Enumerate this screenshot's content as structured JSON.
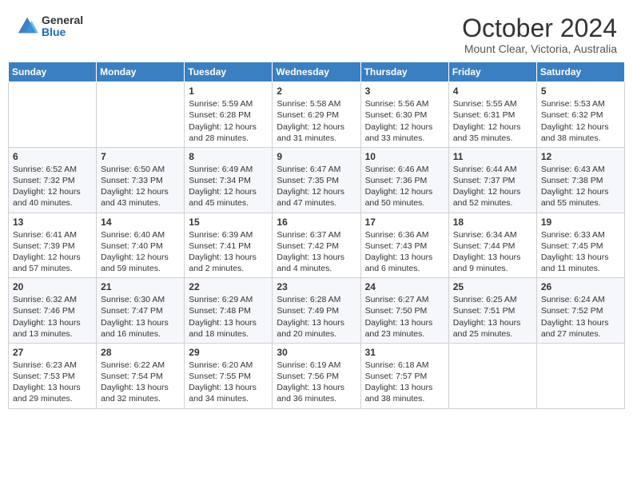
{
  "header": {
    "logo_general": "General",
    "logo_blue": "Blue",
    "title": "October 2024",
    "subtitle": "Mount Clear, Victoria, Australia"
  },
  "weekdays": [
    "Sunday",
    "Monday",
    "Tuesday",
    "Wednesday",
    "Thursday",
    "Friday",
    "Saturday"
  ],
  "weeks": [
    [
      {
        "day": "",
        "info": ""
      },
      {
        "day": "",
        "info": ""
      },
      {
        "day": "1",
        "info": "Sunrise: 5:59 AM\nSunset: 6:28 PM\nDaylight: 12 hours and 28 minutes."
      },
      {
        "day": "2",
        "info": "Sunrise: 5:58 AM\nSunset: 6:29 PM\nDaylight: 12 hours and 31 minutes."
      },
      {
        "day": "3",
        "info": "Sunrise: 5:56 AM\nSunset: 6:30 PM\nDaylight: 12 hours and 33 minutes."
      },
      {
        "day": "4",
        "info": "Sunrise: 5:55 AM\nSunset: 6:31 PM\nDaylight: 12 hours and 35 minutes."
      },
      {
        "day": "5",
        "info": "Sunrise: 5:53 AM\nSunset: 6:32 PM\nDaylight: 12 hours and 38 minutes."
      }
    ],
    [
      {
        "day": "6",
        "info": "Sunrise: 6:52 AM\nSunset: 7:32 PM\nDaylight: 12 hours and 40 minutes."
      },
      {
        "day": "7",
        "info": "Sunrise: 6:50 AM\nSunset: 7:33 PM\nDaylight: 12 hours and 43 minutes."
      },
      {
        "day": "8",
        "info": "Sunrise: 6:49 AM\nSunset: 7:34 PM\nDaylight: 12 hours and 45 minutes."
      },
      {
        "day": "9",
        "info": "Sunrise: 6:47 AM\nSunset: 7:35 PM\nDaylight: 12 hours and 47 minutes."
      },
      {
        "day": "10",
        "info": "Sunrise: 6:46 AM\nSunset: 7:36 PM\nDaylight: 12 hours and 50 minutes."
      },
      {
        "day": "11",
        "info": "Sunrise: 6:44 AM\nSunset: 7:37 PM\nDaylight: 12 hours and 52 minutes."
      },
      {
        "day": "12",
        "info": "Sunrise: 6:43 AM\nSunset: 7:38 PM\nDaylight: 12 hours and 55 minutes."
      }
    ],
    [
      {
        "day": "13",
        "info": "Sunrise: 6:41 AM\nSunset: 7:39 PM\nDaylight: 12 hours and 57 minutes."
      },
      {
        "day": "14",
        "info": "Sunrise: 6:40 AM\nSunset: 7:40 PM\nDaylight: 12 hours and 59 minutes."
      },
      {
        "day": "15",
        "info": "Sunrise: 6:39 AM\nSunset: 7:41 PM\nDaylight: 13 hours and 2 minutes."
      },
      {
        "day": "16",
        "info": "Sunrise: 6:37 AM\nSunset: 7:42 PM\nDaylight: 13 hours and 4 minutes."
      },
      {
        "day": "17",
        "info": "Sunrise: 6:36 AM\nSunset: 7:43 PM\nDaylight: 13 hours and 6 minutes."
      },
      {
        "day": "18",
        "info": "Sunrise: 6:34 AM\nSunset: 7:44 PM\nDaylight: 13 hours and 9 minutes."
      },
      {
        "day": "19",
        "info": "Sunrise: 6:33 AM\nSunset: 7:45 PM\nDaylight: 13 hours and 11 minutes."
      }
    ],
    [
      {
        "day": "20",
        "info": "Sunrise: 6:32 AM\nSunset: 7:46 PM\nDaylight: 13 hours and 13 minutes."
      },
      {
        "day": "21",
        "info": "Sunrise: 6:30 AM\nSunset: 7:47 PM\nDaylight: 13 hours and 16 minutes."
      },
      {
        "day": "22",
        "info": "Sunrise: 6:29 AM\nSunset: 7:48 PM\nDaylight: 13 hours and 18 minutes."
      },
      {
        "day": "23",
        "info": "Sunrise: 6:28 AM\nSunset: 7:49 PM\nDaylight: 13 hours and 20 minutes."
      },
      {
        "day": "24",
        "info": "Sunrise: 6:27 AM\nSunset: 7:50 PM\nDaylight: 13 hours and 23 minutes."
      },
      {
        "day": "25",
        "info": "Sunrise: 6:25 AM\nSunset: 7:51 PM\nDaylight: 13 hours and 25 minutes."
      },
      {
        "day": "26",
        "info": "Sunrise: 6:24 AM\nSunset: 7:52 PM\nDaylight: 13 hours and 27 minutes."
      }
    ],
    [
      {
        "day": "27",
        "info": "Sunrise: 6:23 AM\nSunset: 7:53 PM\nDaylight: 13 hours and 29 minutes."
      },
      {
        "day": "28",
        "info": "Sunrise: 6:22 AM\nSunset: 7:54 PM\nDaylight: 13 hours and 32 minutes."
      },
      {
        "day": "29",
        "info": "Sunrise: 6:20 AM\nSunset: 7:55 PM\nDaylight: 13 hours and 34 minutes."
      },
      {
        "day": "30",
        "info": "Sunrise: 6:19 AM\nSunset: 7:56 PM\nDaylight: 13 hours and 36 minutes."
      },
      {
        "day": "31",
        "info": "Sunrise: 6:18 AM\nSunset: 7:57 PM\nDaylight: 13 hours and 38 minutes."
      },
      {
        "day": "",
        "info": ""
      },
      {
        "day": "",
        "info": ""
      }
    ]
  ]
}
